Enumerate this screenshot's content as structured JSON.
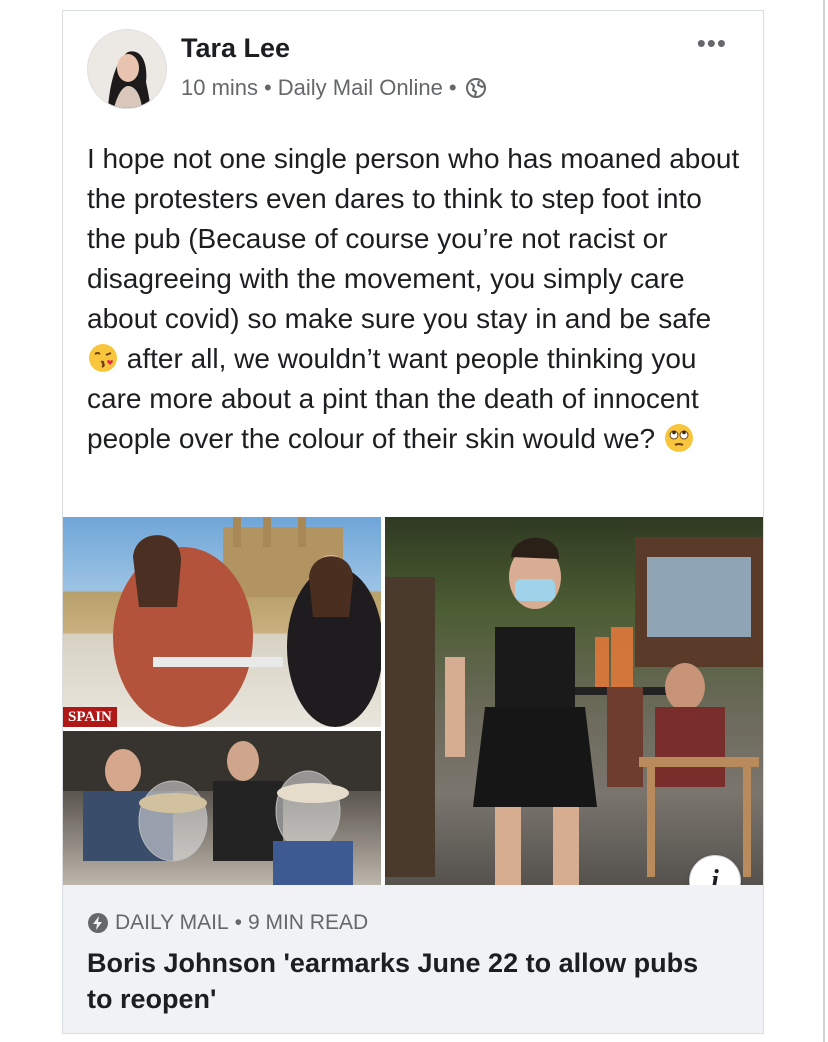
{
  "post": {
    "author": "Tara Lee",
    "time": "10 mins",
    "separator": "•",
    "source": "Daily Mail Online",
    "more_icon": "•••",
    "text_part1": "I hope not one single person who has moaned about the protesters even dares to think to step foot into the pub (Because of course you’re not racist or disagreeing with the movement, you simply care about covid) so make sure you stay in and be safe ",
    "text_part2": " after all, we wouldn’t want people thinking you care more about a pint than the death of innocent people over the colour of their skin would we? ",
    "emoji_1": "kiss-face-emoji",
    "emoji_2": "eye-roll-face-emoji"
  },
  "media": {
    "spain_label": "SPAIN",
    "info_label": "i"
  },
  "link": {
    "source": "DAILY MAIL",
    "separator": "•",
    "read_time": "9 MIN READ",
    "headline": "Boris Johnson 'earmarks June 22 to allow pubs to reopen'"
  },
  "colors": {
    "text_primary": "#1c1e21",
    "text_secondary": "#65676b",
    "footer_bg": "#f0f2f5",
    "spain_tag": "#b01818"
  }
}
